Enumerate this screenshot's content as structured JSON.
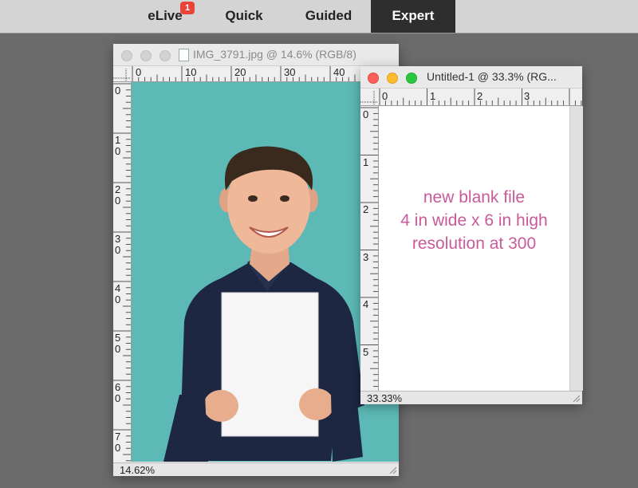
{
  "modes": {
    "tabs": [
      {
        "label": "eLive",
        "badge": "1"
      },
      {
        "label": "Quick"
      },
      {
        "label": "Guided"
      },
      {
        "label": "Expert"
      }
    ],
    "active": "Expert"
  },
  "photo_window": {
    "title": "IMG_3791.jpg @ 14.6% (RGB/8)",
    "zoom": "14.62%",
    "h_ruler": [
      "0",
      "10",
      "20",
      "30",
      "40"
    ],
    "v_ruler": [
      "0",
      "1\n0",
      "2\n0",
      "3\n0",
      "4\n0",
      "5\n0",
      "6\n0",
      "7\n0"
    ]
  },
  "blank_window": {
    "title": "Untitled-1 @ 33.3% (RG...",
    "zoom": "33.33%",
    "h_ruler": [
      "0",
      "1",
      "2",
      "3"
    ],
    "v_ruler": [
      "0",
      "1",
      "2",
      "3",
      "4",
      "5"
    ],
    "note": {
      "line1": "new blank file",
      "line2": "4 in wide x 6 in high",
      "line3": "resolution at 300"
    }
  },
  "colors": {
    "teal_background": "#5db9b6",
    "note_text": "#c95a99",
    "active_tab": "#2e2e2e",
    "badge": "#e9433a"
  }
}
